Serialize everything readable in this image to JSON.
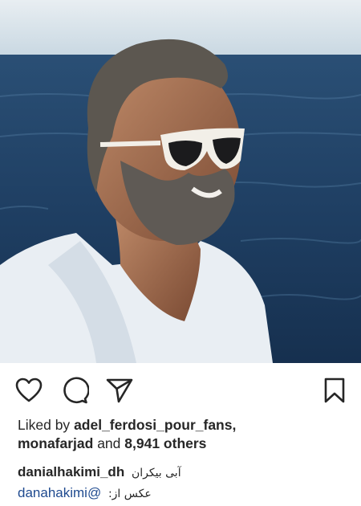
{
  "post": {
    "photo_icon": "post-photo",
    "likes": {
      "prefix": "Liked by",
      "user_one": "adel_ferdosi_pour_fans",
      "separator": ",",
      "user_two": "monafarjad",
      "connector": "and",
      "others": "8,941 others"
    },
    "caption": {
      "username": "danialhakimi_dh",
      "text": "آبی بیکران"
    },
    "credit": {
      "mention": "danahakimi@",
      "text": "عکس از:"
    }
  },
  "actions": {
    "like_icon": "heart-icon",
    "comment_icon": "comment-icon",
    "share_icon": "share-icon",
    "save_icon": "bookmark-icon"
  },
  "colors": {
    "text": "#262626",
    "mention": "#1f4a8f",
    "sea": "#1f3a58",
    "sky": "#dfe9ef"
  }
}
